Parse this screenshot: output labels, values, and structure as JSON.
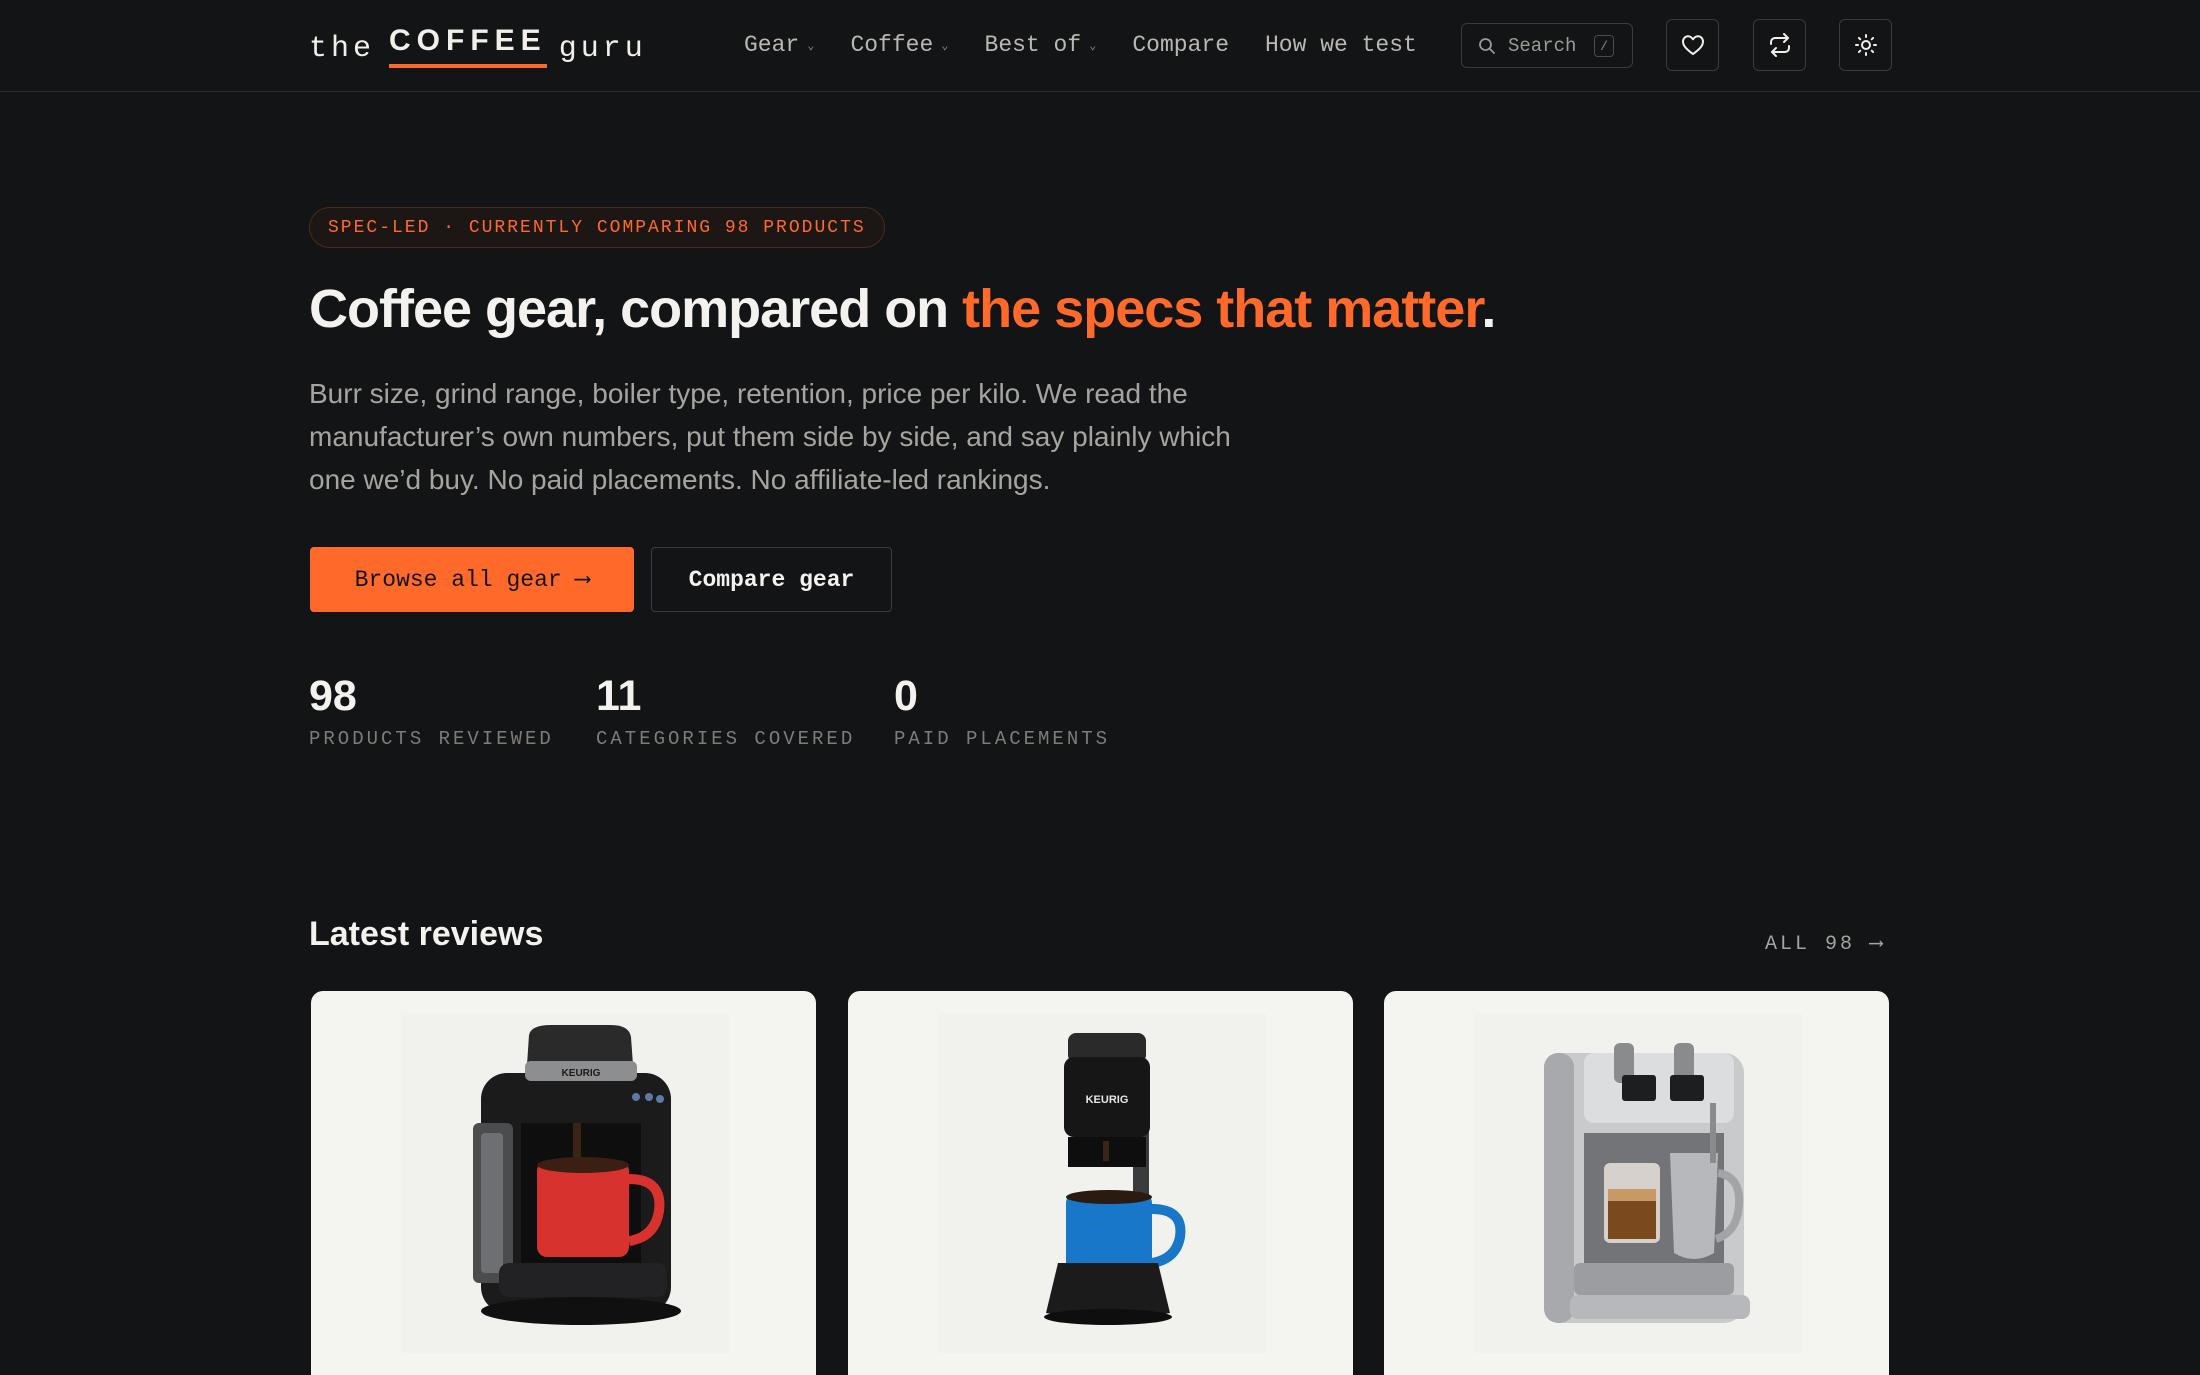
{
  "logo": {
    "the": "the",
    "coffee": "COFFEE",
    "guru": "guru"
  },
  "nav": {
    "items": [
      {
        "label": "Gear",
        "dropdown": true
      },
      {
        "label": "Coffee",
        "dropdown": true
      },
      {
        "label": "Best of",
        "dropdown": true
      },
      {
        "label": "Compare",
        "dropdown": false
      },
      {
        "label": "How we test",
        "dropdown": false
      }
    ],
    "search_placeholder": "Search",
    "search_shortcut": "/",
    "icons": [
      "heart-icon",
      "compare-arrows-icon",
      "sun-icon"
    ]
  },
  "hero": {
    "badge": "SPEC-LED · CURRENTLY COMPARING 98 PRODUCTS",
    "headline_plain": "Coffee gear, compared on ",
    "headline_accent": "the specs that matter",
    "headline_end": ".",
    "lede": "Burr size, grind range, boiler type, retention, price per kilo. We read the manufacturer’s own numbers, put them side by side, and say plainly which one we’d buy. No paid placements. No affiliate-led rankings.",
    "primary_button": "Browse all gear ⟶",
    "secondary_button": "Compare gear"
  },
  "stats": [
    {
      "value": "98",
      "label": "PRODUCTS REVIEWED"
    },
    {
      "value": "11",
      "label": "CATEGORIES COVERED"
    },
    {
      "value": "0",
      "label": "PAID PLACEMENTS"
    }
  ],
  "reviews": {
    "title": "Latest reviews",
    "all_link": "ALL 98 ⟶",
    "cards": [
      {
        "image": "keurig-k-classic-red-mug",
        "brand_text": "KEURIG"
      },
      {
        "image": "keurig-k-slim-blue-mug",
        "brand_text": "KEURIG"
      },
      {
        "image": "breville-creatista-espresso",
        "brand_text": ""
      }
    ]
  },
  "colors": {
    "accent": "#ff6a2b",
    "background": "#131416",
    "card": "#f4f4f1"
  }
}
